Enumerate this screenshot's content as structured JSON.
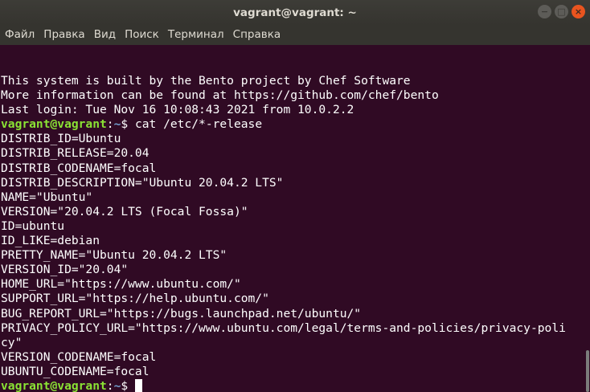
{
  "window": {
    "title": "vagrant@vagrant: ~",
    "controls": {
      "minimize": "−",
      "maximize": "□",
      "close": "×"
    }
  },
  "menu": [
    "Файл",
    "Правка",
    "Вид",
    "Поиск",
    "Терминал",
    "Справка"
  ],
  "terminal": {
    "lines": [
      {
        "text": "This system is built by the Bento project by Chef Software"
      },
      {
        "text": "More information can be found at https://github.com/chef/bento"
      },
      {
        "text": "Last login: Tue Nov 16 10:08:43 2021 from 10.0.2.2"
      },
      {
        "prompt": {
          "user": "vagrant@vagrant",
          "path": "~",
          "sym": "$ "
        },
        "text": "cat /etc/*-release"
      },
      {
        "text": "DISTRIB_ID=Ubuntu"
      },
      {
        "text": "DISTRIB_RELEASE=20.04"
      },
      {
        "text": "DISTRIB_CODENAME=focal"
      },
      {
        "text": "DISTRIB_DESCRIPTION=\"Ubuntu 20.04.2 LTS\""
      },
      {
        "text": "NAME=\"Ubuntu\""
      },
      {
        "text": "VERSION=\"20.04.2 LTS (Focal Fossa)\""
      },
      {
        "text": "ID=ubuntu"
      },
      {
        "text": "ID_LIKE=debian"
      },
      {
        "text": "PRETTY_NAME=\"Ubuntu 20.04.2 LTS\""
      },
      {
        "text": "VERSION_ID=\"20.04\""
      },
      {
        "text": "HOME_URL=\"https://www.ubuntu.com/\""
      },
      {
        "text": "SUPPORT_URL=\"https://help.ubuntu.com/\""
      },
      {
        "text": "BUG_REPORT_URL=\"https://bugs.launchpad.net/ubuntu/\""
      },
      {
        "text": "PRIVACY_POLICY_URL=\"https://www.ubuntu.com/legal/terms-and-policies/privacy-poli"
      },
      {
        "text": "cy\""
      },
      {
        "text": "VERSION_CODENAME=focal"
      },
      {
        "text": "UBUNTU_CODENAME=focal"
      },
      {
        "prompt": {
          "user": "vagrant@vagrant",
          "path": "~",
          "sym": "$ "
        },
        "text": "",
        "cursor": true
      }
    ]
  },
  "colors": {
    "background": "#300a24",
    "prompt_user": "#8ae234",
    "prompt_path": "#729fcf",
    "text": "#ffffff"
  }
}
